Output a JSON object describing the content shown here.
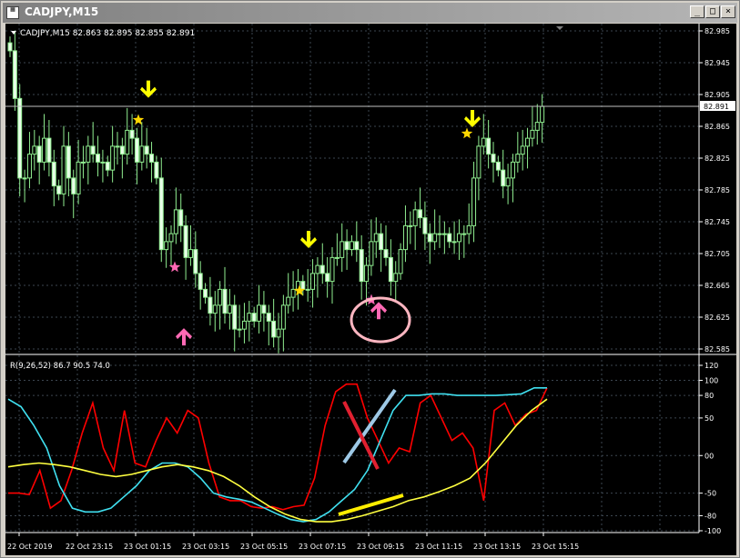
{
  "window": {
    "title": "CADJPY,M15",
    "minimize_label": "_",
    "maximize_label": "□",
    "close_label": "×"
  },
  "main_panel": {
    "info": "CADJPY,M15  82.863 82.895 82.855 82.891",
    "price_axis_labels": [
      "82.985",
      "82.945",
      "82.905",
      "82.865",
      "82.825",
      "82.785",
      "82.745",
      "82.705",
      "82.665",
      "82.625",
      "82.585"
    ],
    "current_price": "82.891"
  },
  "indicator_panel": {
    "info": "R(9,26,52) 86.7 90.5 74.0",
    "axis_labels": [
      "120",
      "100",
      "80",
      "50",
      "00",
      "-50",
      "-80",
      "-100"
    ]
  },
  "time_axis_labels": [
    "22 Oct 2019",
    "22 Oct 23:15",
    "23 Oct 01:15",
    "23 Oct 03:15",
    "23 Oct 05:15",
    "23 Oct 07:15",
    "23 Oct 09:15",
    "23 Oct 11:15",
    "23 Oct 13:15",
    "23 Oct 15:15"
  ],
  "colors": {
    "background": "#000000",
    "grid": "#3c4650",
    "candle": "#90ee90",
    "arrow_down": "#ffff00",
    "arrow_up": "#ff69b4",
    "star_yellow": "#ffd700",
    "star_pink": "#ff69b4",
    "line_red": "#ff0000",
    "line_cyan": "#40e0f0",
    "line_yellow": "#ffff40"
  },
  "chart_data": [
    {
      "type": "candlestick",
      "title": "CADJPY,M15",
      "ylim": [
        82.585,
        82.985
      ],
      "ohlc_last": {
        "open": 82.863,
        "high": 82.895,
        "low": 82.855,
        "close": 82.891
      },
      "close_series": [
        82.96,
        82.9,
        82.8,
        82.8,
        82.83,
        82.84,
        82.82,
        82.85,
        82.82,
        82.79,
        82.78,
        82.84,
        82.8,
        82.78,
        82.82,
        82.82,
        82.84,
        82.83,
        82.82,
        82.82,
        82.81,
        82.84,
        82.84,
        82.83,
        82.86,
        82.85,
        82.82,
        82.84,
        82.83,
        82.82,
        82.8,
        82.71,
        82.72,
        82.73,
        82.76,
        82.74,
        82.7,
        82.71,
        82.68,
        82.66,
        82.65,
        82.63,
        82.64,
        82.66,
        82.63,
        82.64,
        82.61,
        82.61,
        82.62,
        82.63,
        82.62,
        82.64,
        82.63,
        82.62,
        82.6,
        82.61,
        82.64,
        82.65,
        82.66,
        82.67,
        82.66,
        82.66,
        82.68,
        82.69,
        82.68,
        82.67,
        82.7,
        82.7,
        82.72,
        82.71,
        82.72,
        82.71,
        82.67,
        82.69,
        82.72,
        82.73,
        82.71,
        82.7,
        82.67,
        82.68,
        82.71,
        82.74,
        82.74,
        82.76,
        82.75,
        82.73,
        82.72,
        82.73,
        82.73,
        82.73,
        82.72,
        82.72,
        82.73,
        82.73,
        82.74,
        82.8,
        82.84,
        82.85,
        82.83,
        82.82,
        82.81,
        82.79,
        82.8,
        82.82,
        82.83,
        82.84,
        82.85,
        82.86,
        82.87,
        82.89
      ],
      "signals": [
        {
          "type": "arrow_down",
          "color": "yellow",
          "price": 82.902
        },
        {
          "type": "arrow_down",
          "color": "yellow",
          "price": 82.713
        },
        {
          "type": "arrow_down",
          "color": "yellow",
          "price": 82.865
        },
        {
          "type": "arrow_up",
          "color": "pink",
          "price": 82.61
        },
        {
          "type": "arrow_up",
          "color": "pink",
          "price": 82.643
        }
      ]
    },
    {
      "type": "line",
      "title": "R(9,26,52)",
      "ylim": [
        -100,
        120
      ],
      "last_values": [
        86.7,
        90.5,
        74.0
      ],
      "series": [
        {
          "values": [
            -50,
            -50,
            -52,
            -20,
            -70,
            -60,
            -20,
            30,
            70,
            10,
            -20,
            60,
            -10,
            -15,
            20,
            50,
            30,
            60,
            50,
            -10,
            -55,
            -60,
            -60,
            -68,
            -70,
            -68,
            -72,
            -68,
            -66,
            -30,
            40,
            85,
            95,
            95,
            50,
            20,
            -10,
            10,
            5,
            70,
            80,
            50,
            20,
            30,
            10,
            -60,
            60,
            70,
            40,
            55,
            60,
            90
          ]
        },
        {
          "values": [
            75,
            65,
            40,
            10,
            -40,
            -70,
            -75,
            -75,
            -70,
            -55,
            -40,
            -20,
            -10,
            -10,
            -15,
            -30,
            -50,
            -55,
            -58,
            -62,
            -70,
            -78,
            -85,
            -88,
            -85,
            -75,
            -60,
            -45,
            -20,
            20,
            60,
            80,
            80,
            82,
            82,
            80,
            80,
            80,
            80,
            81,
            82,
            90,
            90
          ]
        },
        {
          "values": [
            -15,
            -12,
            -10,
            -12,
            -15,
            -20,
            -25,
            -28,
            -25,
            -20,
            -15,
            -12,
            -15,
            -20,
            -28,
            -40,
            -55,
            -68,
            -78,
            -85,
            -88,
            -88,
            -85,
            -80,
            -74,
            -68,
            -60,
            -55,
            -48,
            -40,
            -30,
            -10,
            15,
            40,
            60,
            75
          ]
        }
      ]
    }
  ]
}
